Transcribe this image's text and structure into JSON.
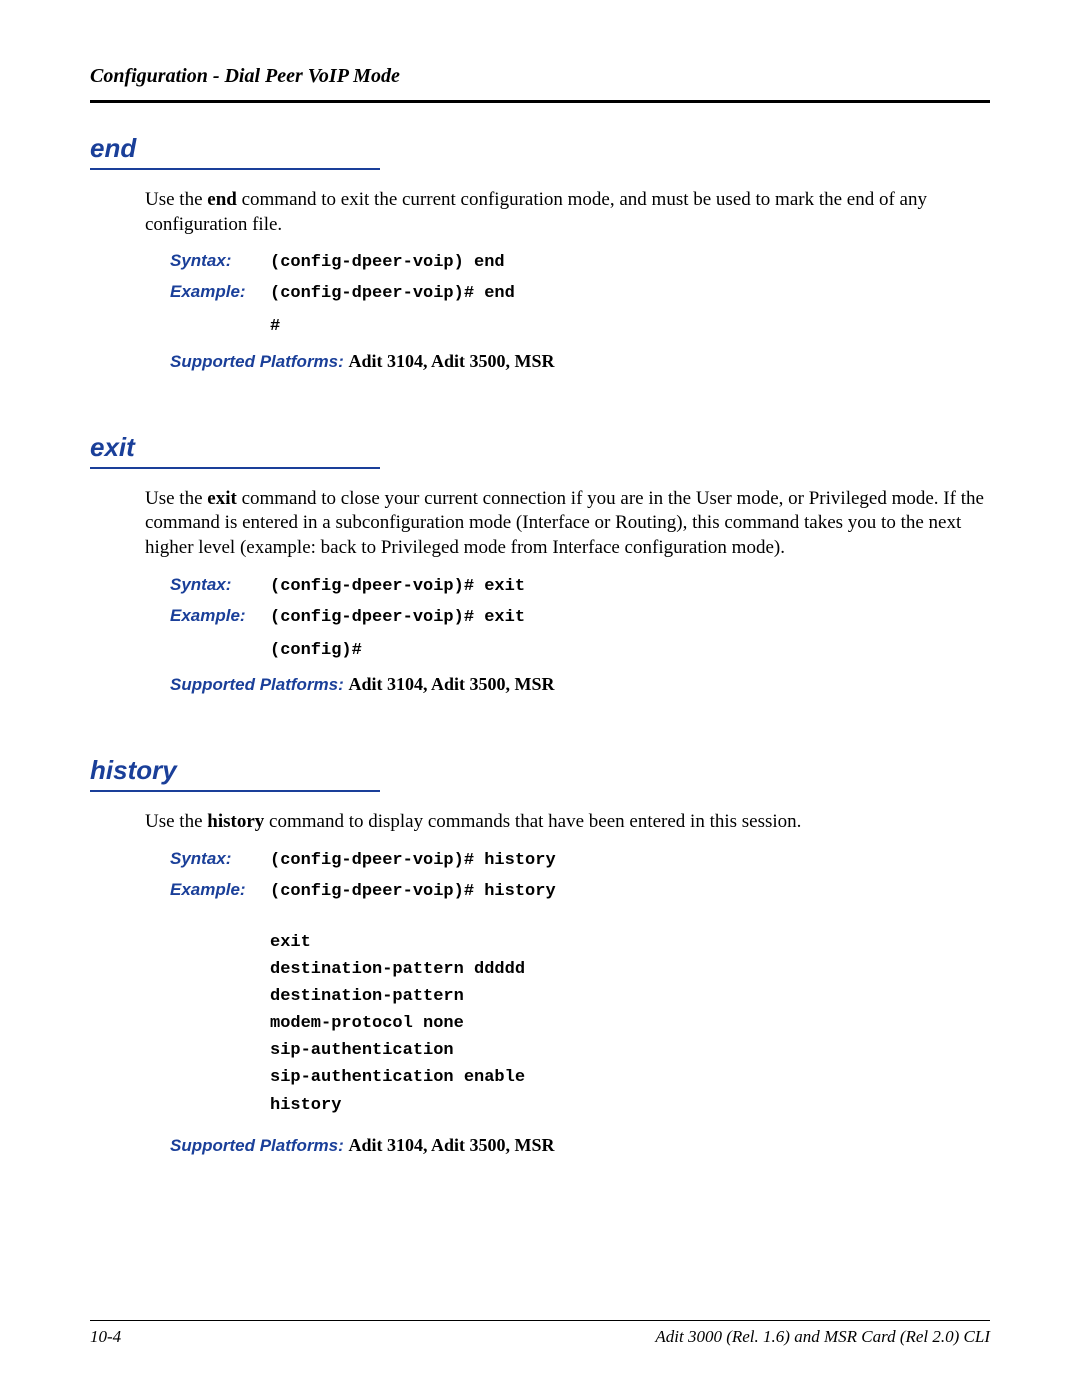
{
  "header": "Configuration - Dial Peer VoIP Mode",
  "sections": {
    "end": {
      "title": "end",
      "desc_pre": "Use the ",
      "desc_cmd": "end",
      "desc_post": " command to exit the current configuration mode, and must be used to mark the end of any configuration file.",
      "syntax_label": "Syntax:",
      "syntax_value": "(config-dpeer-voip) end",
      "example_label": "Example:",
      "example_value": "(config-dpeer-voip)# end",
      "example_extra": "#",
      "platforms_label": "Supported Platforms:  ",
      "platforms_value": "Adit 3104, Adit 3500, MSR"
    },
    "exit": {
      "title": "exit",
      "desc_pre": "Use the ",
      "desc_cmd": "exit",
      "desc_post": " command to close your current connection if you are in the User mode, or Privileged mode. If the command is entered in a subconfiguration mode (Interface or Routing), this command takes you to the next higher level (example: back to Privileged mode from Interface configuration mode).",
      "syntax_label": "Syntax:",
      "syntax_value": "(config-dpeer-voip)# exit",
      "example_label": "Example:",
      "example_value": "(config-dpeer-voip)# exit",
      "example_extra": "(config)#",
      "platforms_label": "Supported Platforms:  ",
      "platforms_value": "Adit 3104, Adit 3500, MSR"
    },
    "history": {
      "title": "history",
      "desc_pre": "Use the ",
      "desc_cmd": "history",
      "desc_post": " command to display commands that have been entered in this session.",
      "syntax_label": "Syntax:",
      "syntax_value": "(config-dpeer-voip)# history",
      "example_label": "Example:",
      "example_value": "(config-dpeer-voip)# history",
      "example_block": "exit\ndestination-pattern ddddd\ndestination-pattern\nmodem-protocol none\nsip-authentication\nsip-authentication enable\nhistory",
      "platforms_label": "Supported Platforms:  ",
      "platforms_value": "Adit 3104, Adit 3500, MSR"
    }
  },
  "footer": {
    "page_number": "10-4",
    "doc_title": "Adit 3000 (Rel. 1.6) and MSR Card (Rel 2.0) CLI"
  }
}
